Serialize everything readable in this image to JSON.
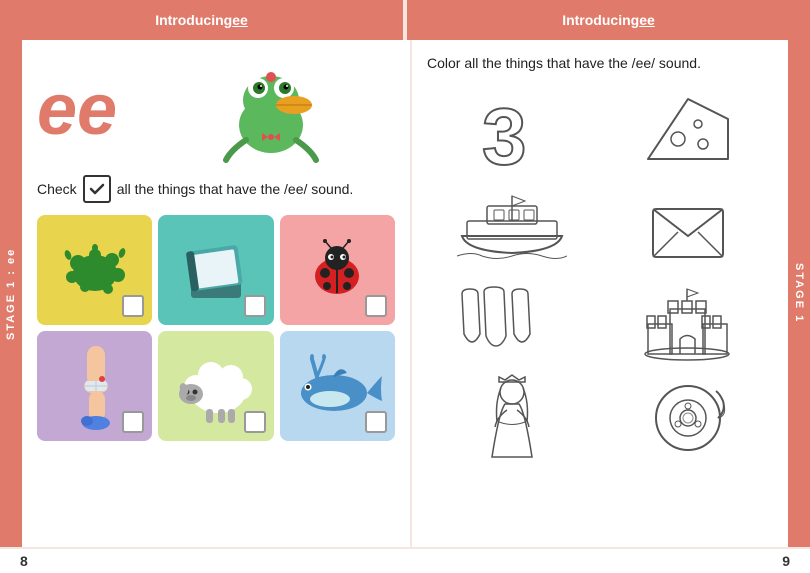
{
  "header": {
    "left_label": "Introducing ",
    "left_ee": "ee",
    "right_label": "Introducing ",
    "right_ee": "ee"
  },
  "stage_left": {
    "line1": "STAGE",
    "line2": "1",
    "line3": ":",
    "line4": "ee"
  },
  "stage_right": {
    "line1": "STAGE",
    "line2": "1"
  },
  "left_panel": {
    "ee_text": "ee",
    "check_instruction_before": "Check",
    "check_instruction_after": "all the things that have the /ee/ sound.",
    "grid_items": [
      {
        "label": "paint splat",
        "bg": "yellow"
      },
      {
        "label": "book",
        "bg": "teal"
      },
      {
        "label": "ladybug",
        "bg": "pink"
      },
      {
        "label": "leg",
        "bg": "purple"
      },
      {
        "label": "sheep",
        "bg": "light-green"
      },
      {
        "label": "whale",
        "bg": "light-blue"
      }
    ]
  },
  "right_panel": {
    "instruction": "Color all the things that have the /ee/ sound.",
    "items": [
      {
        "label": "number three"
      },
      {
        "label": "cheese wedge"
      },
      {
        "label": "boat/ship"
      },
      {
        "label": "envelope"
      },
      {
        "label": "teeth"
      },
      {
        "label": "sandcastle"
      },
      {
        "label": "princess"
      },
      {
        "label": "tape roll"
      }
    ]
  },
  "page_numbers": {
    "left": "8",
    "right": "9"
  }
}
